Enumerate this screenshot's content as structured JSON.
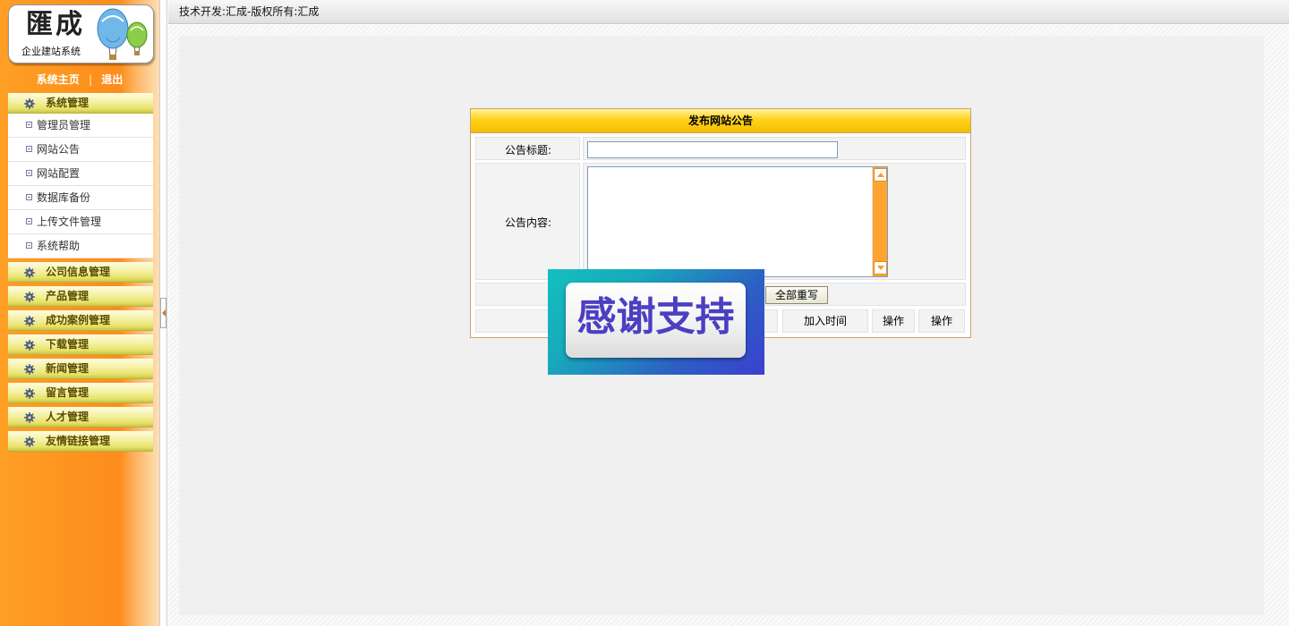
{
  "logo": {
    "mark": "匯成",
    "subtitle": "企业建站系统"
  },
  "top_links": {
    "home": "系统主页",
    "separator": "|",
    "logout": "退出"
  },
  "menu": {
    "system": "系统管理",
    "system_items": [
      "管理员管理",
      "网站公告",
      "网站配置",
      "数据库备份",
      "上传文件管理",
      "系统帮助"
    ],
    "company": "公司信息管理",
    "products": "产品管理",
    "cases": "成功案例管理",
    "downloads": "下载管理",
    "news": "新闻管理",
    "messages": "留言管理",
    "talent": "人才管理",
    "links": "友情链接管理"
  },
  "topbar": {
    "text": "技术开发:汇成-版权所有:汇成"
  },
  "form": {
    "title": "发布网站公告",
    "title_label": "公告标题:",
    "title_value": "",
    "content_label": "公告内容:",
    "content_value": "",
    "reset_button": "全部重写"
  },
  "table": {
    "col_time": "加入时间",
    "col_op1": "操作",
    "col_op2": "操作"
  },
  "badge": {
    "text": "感谢支持"
  },
  "colors": {
    "sidebar": "#fe8c1c",
    "menu_head": "#e7e36a",
    "title_bar": "#ffd21c",
    "badge_text": "#4b3fc2"
  }
}
